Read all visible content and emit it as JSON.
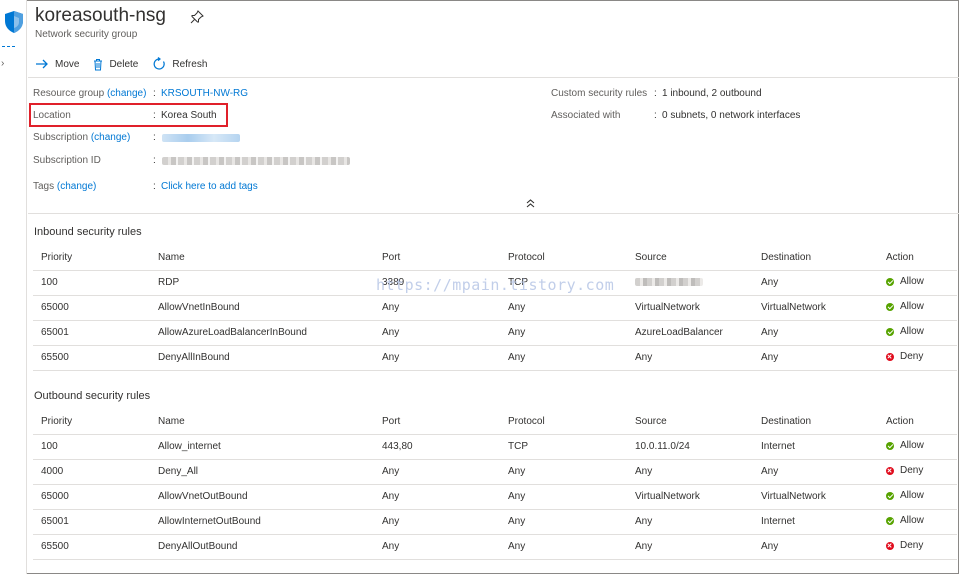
{
  "header": {
    "title": "koreasouth-nsg",
    "subtitle": "Network security group"
  },
  "toolbar": {
    "move_label": "Move",
    "delete_label": "Delete",
    "refresh_label": "Refresh"
  },
  "essentials": {
    "resource_group_label": "Resource group",
    "change_label": "(change)",
    "resource_group_value": "KRSOUTH-NW-RG",
    "location_label": "Location",
    "location_value": "Korea South",
    "subscription_label": "Subscription",
    "subscription_id_label": "Subscription ID",
    "tags_label": "Tags",
    "tags_value": "Click here to add tags",
    "custom_rules_label": "Custom security rules",
    "custom_rules_value": "1 inbound, 2 outbound",
    "associated_label": "Associated with",
    "associated_value": "0 subnets, 0 network interfaces",
    "separator": ":"
  },
  "inbound": {
    "title": "Inbound security rules",
    "columns": [
      "Priority",
      "Name",
      "Port",
      "Protocol",
      "Source",
      "Destination",
      "Action"
    ],
    "rows": [
      {
        "priority": "100",
        "name": "RDP",
        "port": "3389",
        "protocol": "TCP",
        "source": "",
        "destination": "Any",
        "action": "Allow"
      },
      {
        "priority": "65000",
        "name": "AllowVnetInBound",
        "port": "Any",
        "protocol": "Any",
        "source": "VirtualNetwork",
        "destination": "VirtualNetwork",
        "action": "Allow"
      },
      {
        "priority": "65001",
        "name": "AllowAzureLoadBalancerInBound",
        "port": "Any",
        "protocol": "Any",
        "source": "AzureLoadBalancer",
        "destination": "Any",
        "action": "Allow"
      },
      {
        "priority": "65500",
        "name": "DenyAllInBound",
        "port": "Any",
        "protocol": "Any",
        "source": "Any",
        "destination": "Any",
        "action": "Deny"
      }
    ]
  },
  "outbound": {
    "title": "Outbound security rules",
    "columns": [
      "Priority",
      "Name",
      "Port",
      "Protocol",
      "Source",
      "Destination",
      "Action"
    ],
    "rows": [
      {
        "priority": "100",
        "name": "Allow_internet",
        "port": "443,80",
        "protocol": "TCP",
        "source": "10.0.11.0/24",
        "destination": "Internet",
        "action": "Allow"
      },
      {
        "priority": "4000",
        "name": "Deny_All",
        "port": "Any",
        "protocol": "Any",
        "source": "Any",
        "destination": "Any",
        "action": "Deny"
      },
      {
        "priority": "65000",
        "name": "AllowVnetOutBound",
        "port": "Any",
        "protocol": "Any",
        "source": "VirtualNetwork",
        "destination": "VirtualNetwork",
        "action": "Allow"
      },
      {
        "priority": "65001",
        "name": "AllowInternetOutBound",
        "port": "Any",
        "protocol": "Any",
        "source": "Any",
        "destination": "Internet",
        "action": "Allow"
      },
      {
        "priority": "65500",
        "name": "DenyAllOutBound",
        "port": "Any",
        "protocol": "Any",
        "source": "Any",
        "destination": "Any",
        "action": "Deny"
      }
    ]
  },
  "watermark": "https://mpain.tistory.com",
  "colors": {
    "accent": "#0078d4",
    "allow": "#57a300",
    "deny": "#e00b1c",
    "highlight": "#e0202a"
  },
  "icons": {
    "resource": "shield-icon",
    "pin": "pin-icon",
    "move": "arrow-right-icon",
    "delete": "trash-icon",
    "refresh": "refresh-icon",
    "collapse": "double-chevron-up-icon",
    "allow": "check-circle-icon",
    "deny": "x-circle-icon"
  }
}
